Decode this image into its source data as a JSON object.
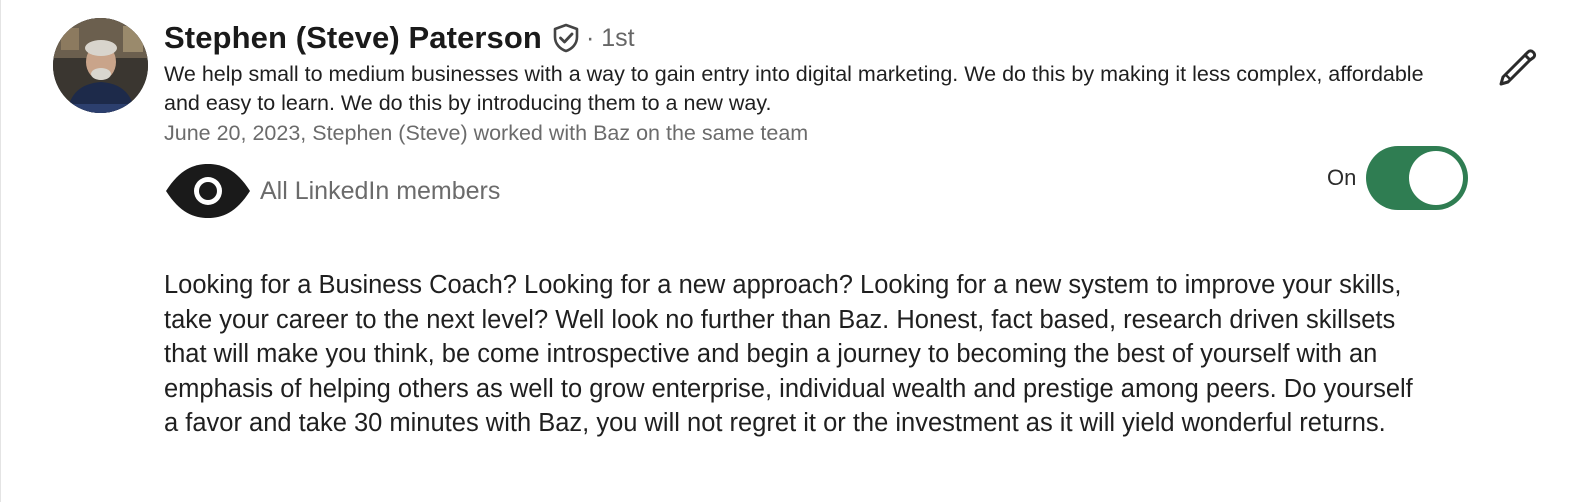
{
  "recommendation": {
    "author_name": "Stephen (Steve) Paterson",
    "connection_degree": "· 1st",
    "headline": "We help small to medium businesses with a way to gain entry into digital marketing. We do this by making it less complex, affordable and easy to learn. We do this by introducing them to a new way.",
    "date_relationship": "June 20, 2023, Stephen (Steve) worked with Baz on the same team",
    "visibility_label": "All LinkedIn members",
    "toggle_label": "On",
    "toggle_state": true,
    "text": "Looking for a Business Coach? Looking for a new approach? Looking for a new system to improve your skills, take your career to the next level? Well look no further than Baz. Honest, fact based, research driven skillsets that will make you think, be come introspective and begin a journey to becoming the best of yourself with an emphasis of helping others as well to grow enterprise, individual wealth and prestige among peers. Do yourself a favor and take 30 minutes with Baz, you will not regret it or the investment as it will yield wonderful returns."
  },
  "icons": {
    "verified": "verified-shield-icon",
    "visibility": "eye-icon",
    "edit": "pencil-icon"
  },
  "colors": {
    "toggle_on": "#2f7d52",
    "secondary_text": "#6b6b6b",
    "primary_text": "#1f1f1f"
  }
}
